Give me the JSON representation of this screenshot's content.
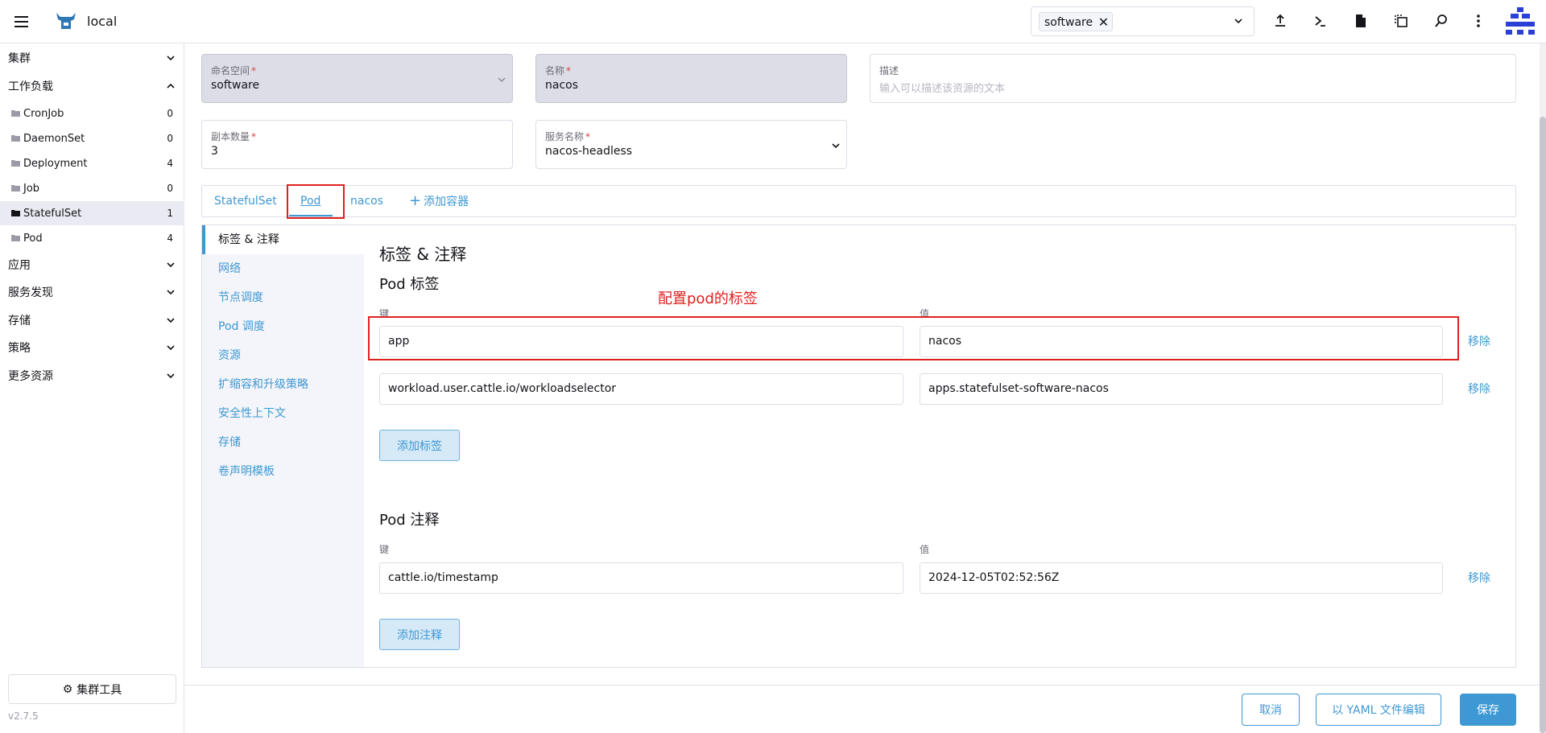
{
  "header": {
    "cluster_name": "local",
    "namespace_chip": "software",
    "icons": [
      "menu-icon",
      "cow-logo-icon",
      "chevron-down-icon",
      "upload-icon",
      "terminal-icon",
      "file-icon",
      "copy-config-icon",
      "search-icon",
      "more-vertical-icon",
      "user-avatar-icon"
    ]
  },
  "sidebar": {
    "groups": [
      "集群",
      "工作负载",
      "应用",
      "服务发现",
      "存储",
      "策略",
      "更多资源"
    ],
    "workload_items": [
      {
        "label": "CronJob",
        "count": "0"
      },
      {
        "label": "DaemonSet",
        "count": "0"
      },
      {
        "label": "Deployment",
        "count": "4"
      },
      {
        "label": "Job",
        "count": "0"
      },
      {
        "label": "StatefulSet",
        "count": "1"
      },
      {
        "label": "Pod",
        "count": "4"
      }
    ],
    "cluster_tools": "集群工具",
    "version": "v2.7.5"
  },
  "form": {
    "namespace": {
      "label": "命名空间",
      "value": "software"
    },
    "name": {
      "label": "名称",
      "value": "nacos"
    },
    "description": {
      "label": "描述",
      "placeholder": "输入可以描述该资源的文本"
    },
    "replicas": {
      "label": "副本数量",
      "value": "3"
    },
    "service_name": {
      "label": "服务名称",
      "value": "nacos-headless"
    }
  },
  "tabs": [
    "StatefulSet",
    "Pod",
    "nacos",
    "添加容器"
  ],
  "side_tabs": [
    "标签 & 注释",
    "网络",
    "节点调度",
    "Pod 调度",
    "资源",
    "扩缩容和升级策略",
    "安全性上下文",
    "存储",
    "卷声明模板"
  ],
  "labels_section": {
    "title": "标签 & 注释",
    "pod_labels_title": "Pod 标签",
    "key_label": "键",
    "value_label": "值",
    "rows": [
      {
        "key": "app",
        "value": "nacos",
        "remove": "移除"
      },
      {
        "key": "workload.user.cattle.io/workloadselector",
        "value": "apps.statefulset-software-nacos",
        "remove": "移除"
      }
    ],
    "add_label": "添加标签",
    "annotation_text": "配置pod的标签"
  },
  "annotations_section": {
    "title": "Pod 注释",
    "key_label": "键",
    "value_label": "值",
    "rows": [
      {
        "key": "cattle.io/timestamp",
        "value": "2024-12-05T02:52:56Z",
        "remove": "移除"
      }
    ],
    "add_annotation": "添加注释"
  },
  "footer": {
    "cancel": "取消",
    "edit_yaml": "以 YAML 文件编辑",
    "save": "保存"
  },
  "colors": {
    "accent": "#3d98d3",
    "highlight": "#e02020"
  }
}
